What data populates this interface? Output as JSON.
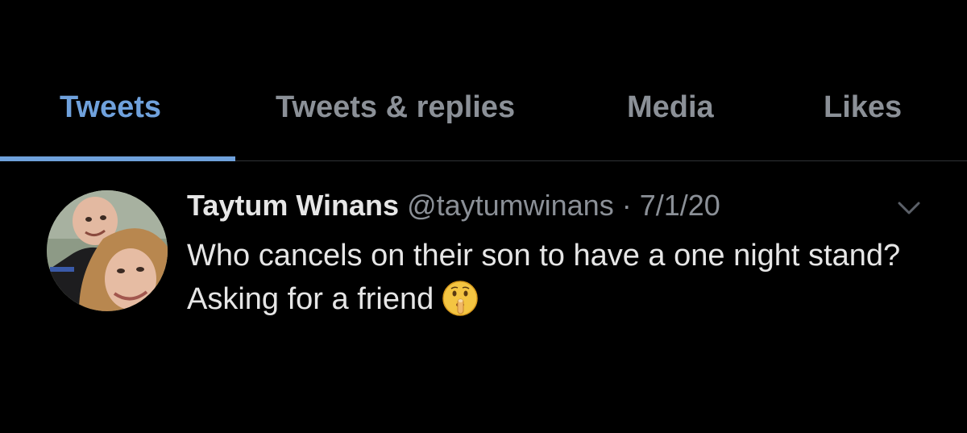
{
  "tabs": [
    {
      "label": "Tweets",
      "active": true
    },
    {
      "label": "Tweets & replies",
      "active": false
    },
    {
      "label": "Media",
      "active": false
    },
    {
      "label": "Likes",
      "active": false
    }
  ],
  "tweet": {
    "author_name": "Taytum Winans",
    "handle": "@taytumwinans",
    "separator": "·",
    "date": "7/1/20",
    "text": "Who cancels on their son to have a one night stand? Asking for a friend",
    "emoji": "shushing-face-emoji",
    "avatar": "profile-photo"
  },
  "colors": {
    "background": "#000000",
    "accent": "#6fa1dc",
    "muted_text": "#8b9097",
    "primary_text": "#e6e6e6",
    "divider": "#2f3336"
  },
  "icons": {
    "more_options": "chevron-down-icon"
  }
}
